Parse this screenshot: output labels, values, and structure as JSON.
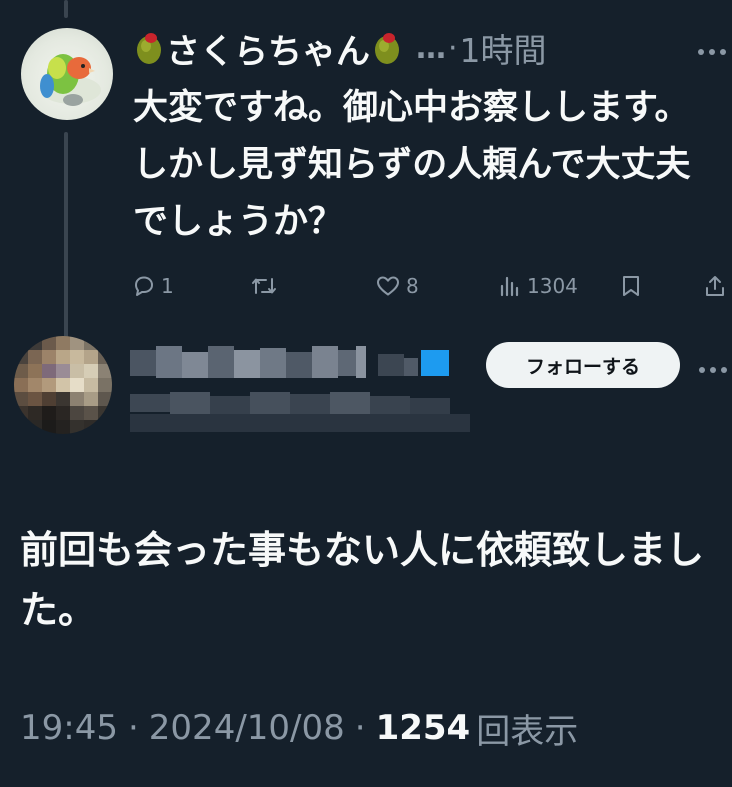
{
  "reply": {
    "display_name": "さくらちゃん",
    "name_suffix": "…",
    "separator": "·",
    "time_ago": "1時間",
    "text": "大変ですね。御心中お察しします。しかし見ず知らずの人頼んで大丈夫でしょうか？",
    "actions": {
      "reply_count": "1",
      "repost_count": "",
      "like_count": "8",
      "view_count": "1304"
    }
  },
  "original": {
    "follow_label": "フォローする",
    "text": "前回も会った事もない人に依頼致しました。",
    "time": "19:45",
    "separator": "·",
    "date": "2024/10/08",
    "views_count": "1254",
    "views_label": "回表示"
  },
  "icons": {
    "olive": "olive-emoji-icon",
    "more": "more-horizontal-icon",
    "reply": "reply-icon",
    "repost": "repost-icon",
    "like": "heart-icon",
    "views": "views-chart-icon",
    "bookmark": "bookmark-icon",
    "share": "share-icon",
    "verified": "verified-badge-icon"
  },
  "colors": {
    "background": "#15202b",
    "text_primary": "#f7f9f9",
    "text_secondary": "#8b98a5",
    "follow_button_bg": "#eff3f4",
    "verified_blue": "#1d9bf0"
  }
}
